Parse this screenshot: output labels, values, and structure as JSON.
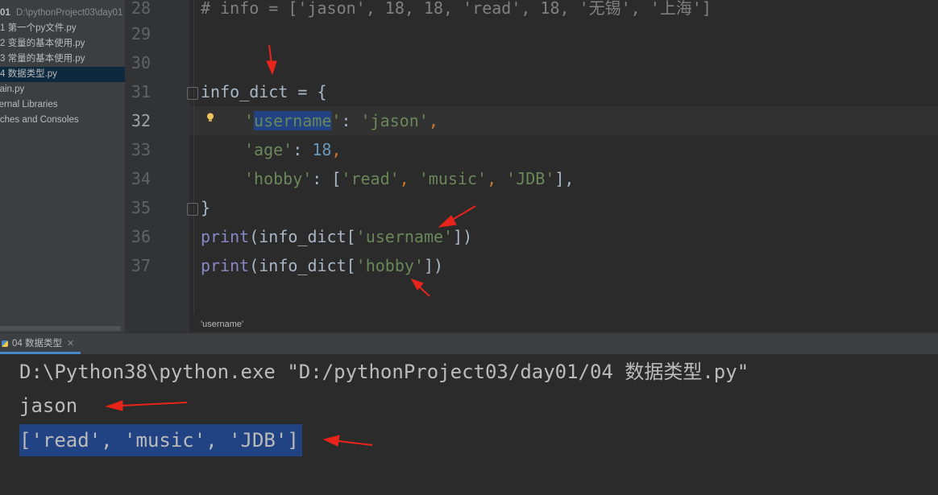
{
  "project": {
    "root_label": "01",
    "root_path": "D:\\pythonProject03\\day01",
    "files": [
      {
        "label": "1 第一个py文件.py"
      },
      {
        "label": "2 变量的基本使用.py"
      },
      {
        "label": "3 常量的基本使用.py"
      },
      {
        "label": "4 数据类型.py",
        "selected": true
      },
      {
        "label": "main.py"
      }
    ],
    "external_libraries": "External Libraries",
    "scratches": "Scratches and Consoles"
  },
  "editor": {
    "line_numbers": [
      "28",
      "29",
      "30",
      "31",
      "32",
      "33",
      "34",
      "35",
      "36",
      "37"
    ],
    "current_line": "32",
    "lines": {
      "l28": "# info = ['jason', 18, 18, 'read', 18, '无锡', '上海']",
      "l31_a": "info_dict",
      "l31_b": " = {",
      "l32_q1": "'",
      "l32_key": "username",
      "l32_q2": "'",
      "l32_colon": ": ",
      "l32_val": "'jason'",
      "l32_comma": ",",
      "l33_key": "'age'",
      "l33_colon": ": ",
      "l33_val": "18",
      "l33_comma": ",",
      "l34_key": "'hobby'",
      "l34_open": ": [",
      "l34_v1": "'read'",
      "l34_sep1": ", ",
      "l34_v2": "'music'",
      "l34_sep2": ", ",
      "l34_v3": "'JDB'",
      "l34_close": "],",
      "l35": "}",
      "l36_fn": "print",
      "l36_a": "(info_dict[",
      "l36_str": "'username'",
      "l36_b": "])",
      "l37_fn": "print",
      "l37_a": "(info_dict[",
      "l37_str": "'hobby'",
      "l37_b": "])"
    },
    "breadcrumb": "'username'"
  },
  "run": {
    "tab_label": "04 数据类型",
    "console": [
      "D:\\Python38\\python.exe \"D:/pythonProject03/day01/04 数据类型.py\"",
      "jason",
      "['read', 'music', 'JDB']"
    ]
  },
  "colors": {
    "annotation_arrow": "#e8241b",
    "selection": "#214283",
    "string": "#6a8759",
    "number": "#6897bb"
  }
}
